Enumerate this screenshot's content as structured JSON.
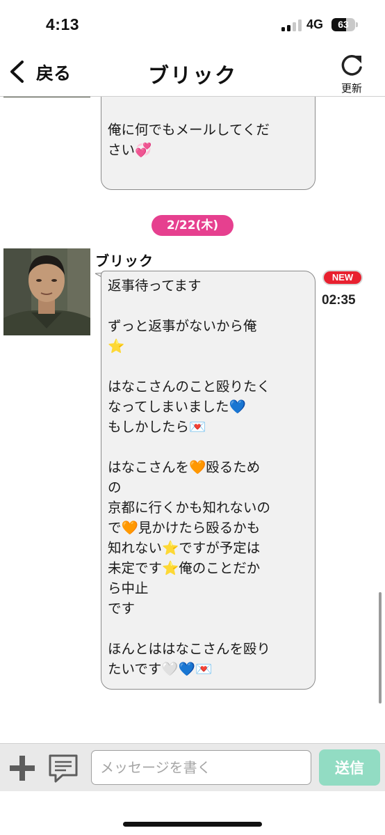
{
  "status_bar": {
    "time": "4:13",
    "network": "4G",
    "battery": "63",
    "battery_level": 0.63
  },
  "nav": {
    "back_label": "戻る",
    "title": "ブリック",
    "refresh_label": "更新"
  },
  "chat": {
    "previous_message": {
      "lines": [
        {
          "segments": [
            {
              "text": "⭐",
              "kind": "star"
            }
          ]
        },
        {
          "segments": [
            {
              "text": ""
            }
          ]
        },
        {
          "segments": [
            {
              "text": "俺に何でもメールしてくだ"
            }
          ]
        },
        {
          "segments": [
            {
              "text": "さい"
            },
            {
              "text": "💞",
              "kind": "heart-pink"
            }
          ]
        }
      ]
    },
    "date_label": "2/22(木)",
    "message": {
      "sender": "ブリック",
      "badge": "NEW",
      "time": "02:35",
      "lines": [
        {
          "segments": [
            {
              "text": "返事待ってます"
            }
          ]
        },
        {
          "segments": [
            {
              "text": ""
            }
          ]
        },
        {
          "segments": [
            {
              "text": "ずっと返事がないから俺"
            }
          ]
        },
        {
          "segments": [
            {
              "text": "⭐",
              "kind": "star"
            }
          ]
        },
        {
          "segments": [
            {
              "text": ""
            }
          ]
        },
        {
          "segments": [
            {
              "text": "はなこさんのこと殴りたく"
            }
          ]
        },
        {
          "segments": [
            {
              "text": "なってしまいました"
            },
            {
              "text": "💙",
              "kind": "heart-blue"
            }
          ]
        },
        {
          "segments": [
            {
              "text": "もしかしたら"
            },
            {
              "text": "💌",
              "kind": "letter"
            }
          ]
        },
        {
          "segments": [
            {
              "text": ""
            }
          ]
        },
        {
          "segments": [
            {
              "text": "はなこさんを"
            },
            {
              "text": "🧡",
              "kind": "heart-orange"
            },
            {
              "text": "殴るため"
            }
          ]
        },
        {
          "segments": [
            {
              "text": "の"
            }
          ]
        },
        {
          "segments": [
            {
              "text": "京都に行くかも知れないの"
            }
          ]
        },
        {
          "segments": [
            {
              "text": "で"
            },
            {
              "text": "🧡",
              "kind": "heart-orange"
            },
            {
              "text": "見かけたら殴るかも"
            }
          ]
        },
        {
          "segments": [
            {
              "text": "知れない"
            },
            {
              "text": "⭐",
              "kind": "star"
            },
            {
              "text": "ですが予定は"
            }
          ]
        },
        {
          "segments": [
            {
              "text": "未定です"
            },
            {
              "text": "⭐",
              "kind": "star"
            },
            {
              "text": "俺のことだか"
            }
          ]
        },
        {
          "segments": [
            {
              "text": "ら中止"
            }
          ]
        },
        {
          "segments": [
            {
              "text": "です"
            }
          ]
        },
        {
          "segments": [
            {
              "text": ""
            }
          ]
        },
        {
          "segments": [
            {
              "text": "ほんとははなこさんを殴り"
            }
          ]
        },
        {
          "segments": [
            {
              "text": "たいです"
            },
            {
              "text": "🤍",
              "kind": "heart-white"
            },
            {
              "text": "💙",
              "kind": "heart-blue"
            },
            {
              "text": "💌",
              "kind": "letter"
            }
          ]
        }
      ]
    }
  },
  "input": {
    "placeholder": "メッセージを書く",
    "value": "",
    "send_label": "送信"
  },
  "colors": {
    "date_badge": "#e6408f",
    "new_badge": "#e8202f",
    "send_button": "#92dcc3",
    "bubble": "#f1f1f1"
  },
  "icons": {
    "back": "chevron-left-icon",
    "refresh": "refresh-icon",
    "plus": "plus-icon",
    "memo": "memo-icon"
  }
}
